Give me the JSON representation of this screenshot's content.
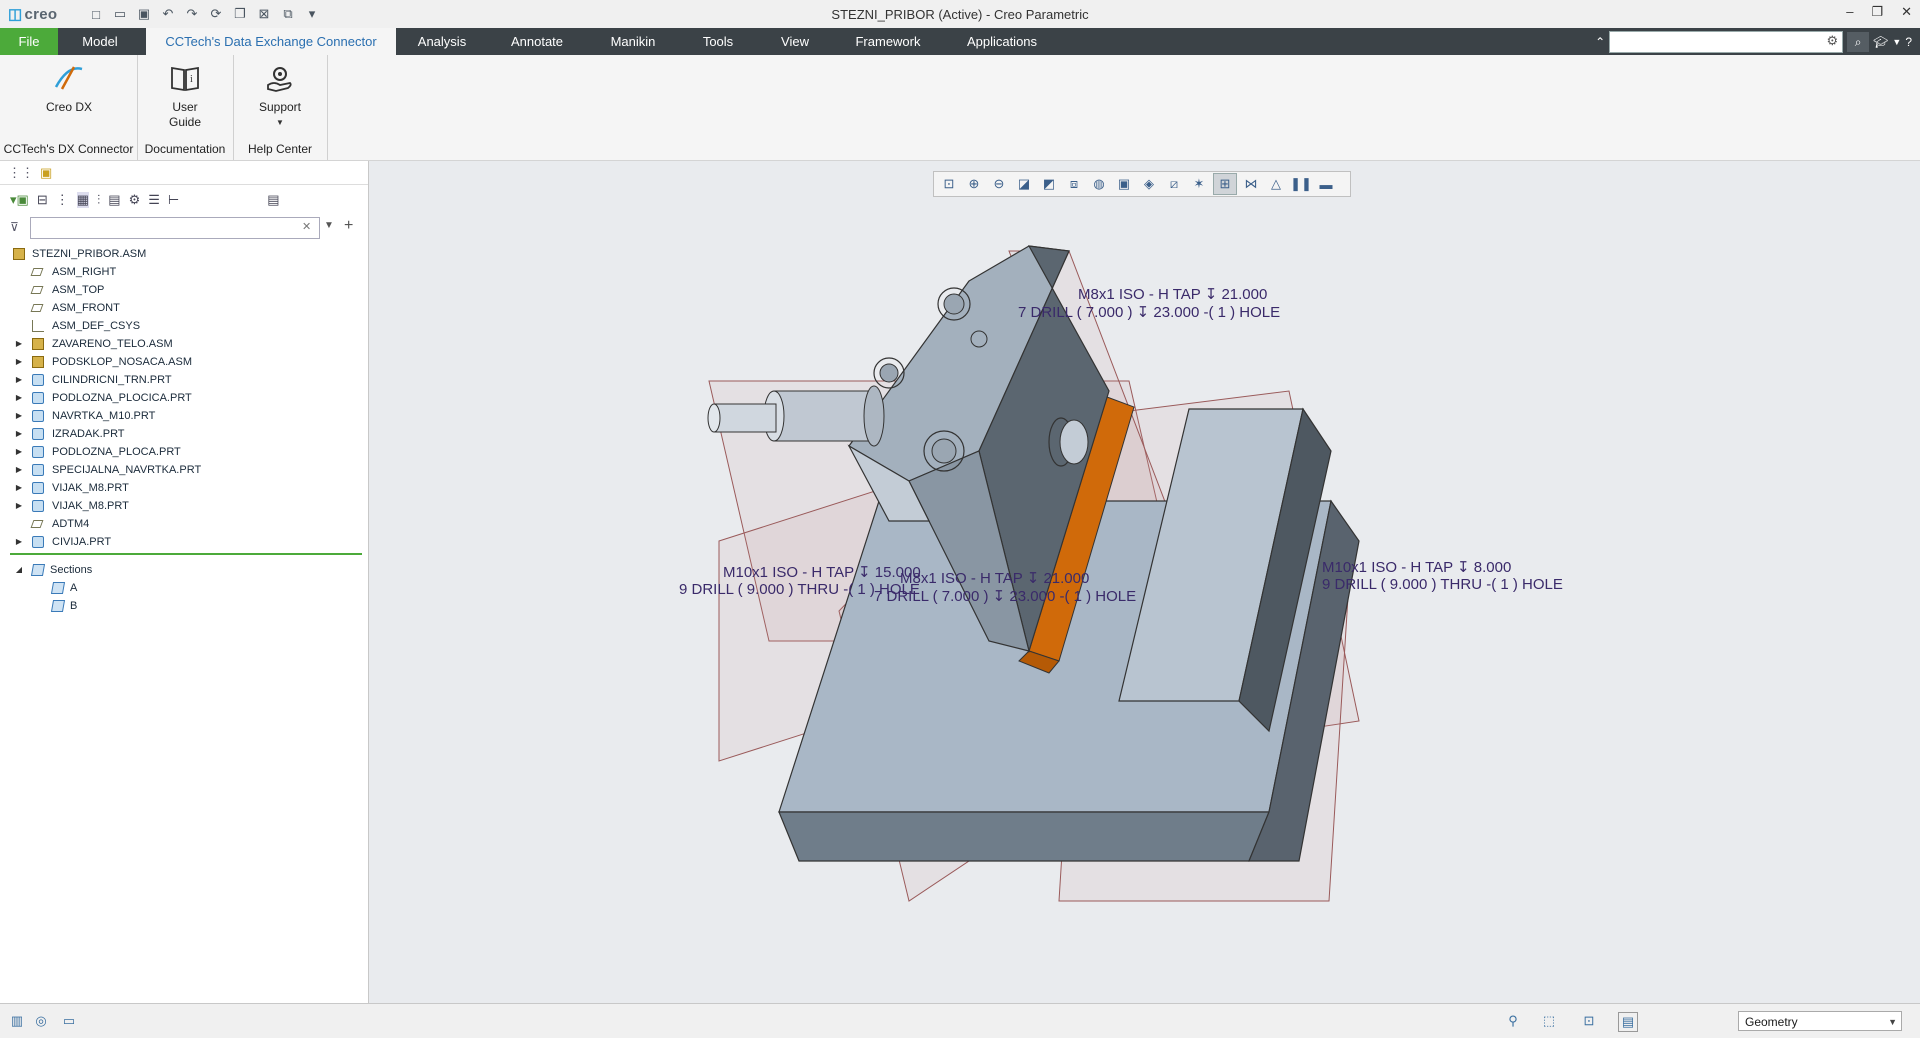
{
  "app": {
    "logo": "creo",
    "window_title": "STEZNI_PRIBOR (Active) - Creo Parametric"
  },
  "tabs": [
    {
      "label": "File"
    },
    {
      "label": "Model"
    },
    {
      "label": "CCTech's Data Exchange Connector"
    },
    {
      "label": "Analysis"
    },
    {
      "label": "Annotate"
    },
    {
      "label": "Manikin"
    },
    {
      "label": "Tools"
    },
    {
      "label": "View"
    },
    {
      "label": "Framework"
    },
    {
      "label": "Applications"
    }
  ],
  "ribbon": {
    "groups": [
      {
        "label": "CCTech's DX Connector",
        "buttons": [
          {
            "label": "Creo DX"
          }
        ]
      },
      {
        "label": "Documentation",
        "buttons": [
          {
            "label": "User",
            "label2": "Guide"
          }
        ]
      },
      {
        "label": "Help Center",
        "buttons": [
          {
            "label": "Support"
          }
        ]
      }
    ]
  },
  "search": {
    "value": ""
  },
  "model_tree": {
    "filter_value": "",
    "root": "STEZNI_PRIBOR.ASM",
    "items": [
      {
        "label": "ASM_RIGHT",
        "kind": "plane",
        "expandable": false
      },
      {
        "label": "ASM_TOP",
        "kind": "plane",
        "expandable": false
      },
      {
        "label": "ASM_FRONT",
        "kind": "plane",
        "expandable": false
      },
      {
        "label": "ASM_DEF_CSYS",
        "kind": "csys",
        "expandable": false
      },
      {
        "label": "ZAVARENO_TELO.ASM",
        "kind": "asm",
        "expandable": true
      },
      {
        "label": "PODSKLOP_NOSACA.ASM",
        "kind": "asm",
        "expandable": true
      },
      {
        "label": "CILINDRICNI_TRN.PRT",
        "kind": "prt",
        "expandable": true
      },
      {
        "label": "PODLOZNA_PLOCICA.PRT",
        "kind": "prt",
        "expandable": true
      },
      {
        "label": "NAVRTKA_M10.PRT",
        "kind": "prt",
        "expandable": true
      },
      {
        "label": "IZRADAK.PRT",
        "kind": "prt",
        "expandable": true
      },
      {
        "label": "PODLOZNA_PLOCA.PRT",
        "kind": "prt",
        "expandable": true
      },
      {
        "label": "SPECIJALNA_NAVRTKA.PRT",
        "kind": "prt",
        "expandable": true
      },
      {
        "label": "VIJAK_M8.PRT",
        "kind": "prt",
        "expandable": true
      },
      {
        "label": "VIJAK_M8.PRT",
        "kind": "prt",
        "expandable": true
      },
      {
        "label": "ADTM4",
        "kind": "plane",
        "expandable": false
      },
      {
        "label": "CIVIJA.PRT",
        "kind": "prt",
        "expandable": true
      }
    ],
    "sections": {
      "label": "Sections",
      "items": [
        "A",
        "B"
      ]
    }
  },
  "annotations": [
    {
      "line1": "M8x1 ISO - H TAP ↧ 21.000",
      "line2": "7 DRILL ( 7.000 ) ↧ 23.000 -( 1 ) HOLE"
    },
    {
      "line1": "M10x1 ISO - H TAP ↧ 15.000",
      "line2": "9 DRILL ( 9.000 )  THRU  -( 1 ) HOLE"
    },
    {
      "line1": "M8x1 ISO - H TAP ↧ 21.000",
      "line2": "7 DRILL ( 7.000 ) ↧ 23.000 -( 1 ) HOLE"
    },
    {
      "line1": "M10x1 ISO - H TAP ↧ 8.000",
      "line2": "9 DRILL ( 9.000 )  THRU  -( 1 ) HOLE"
    }
  ],
  "status": {
    "filter_value": "Geometry"
  },
  "colors": {
    "file_tab": "#4caa3a",
    "tab_bar": "#3b4247",
    "active_tab_text": "#2a6fb0",
    "highlight_part": "#d06a0a"
  }
}
